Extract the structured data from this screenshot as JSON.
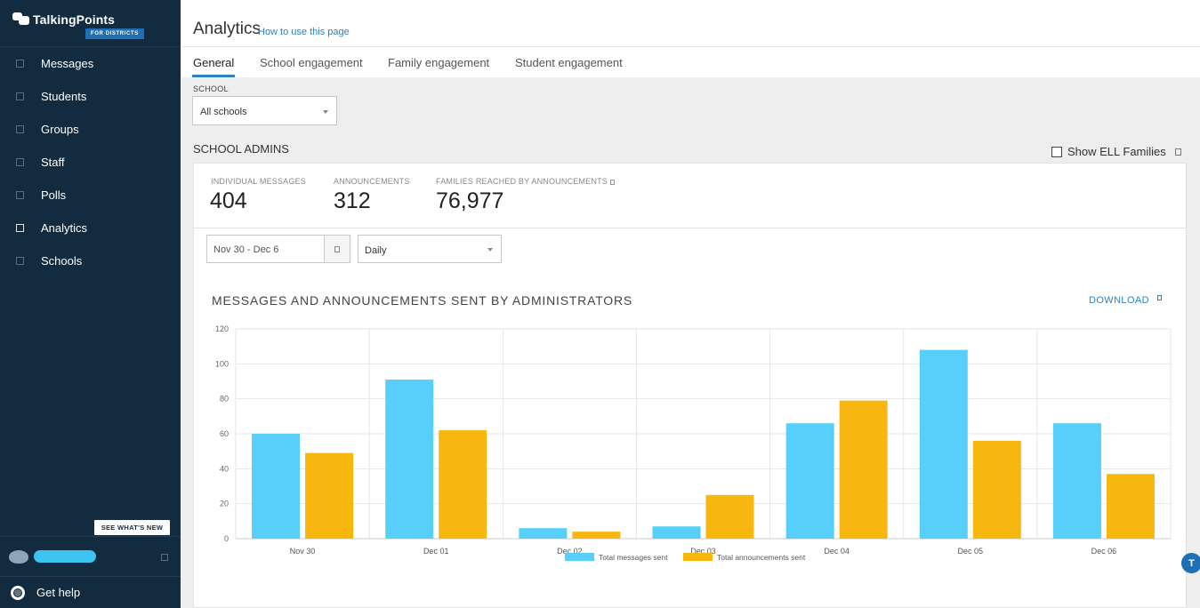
{
  "sidebar": {
    "logo_text": "TalkingPoints",
    "logo_badge": "FOR DISTRICTS",
    "items": [
      {
        "label": "Messages",
        "icon": "chat-icon"
      },
      {
        "label": "Students",
        "icon": "students-icon"
      },
      {
        "label": "Groups",
        "icon": "groups-icon"
      },
      {
        "label": "Staff",
        "icon": "staff-icon"
      },
      {
        "label": "Polls",
        "icon": "polls-icon"
      },
      {
        "label": "Analytics",
        "icon": "analytics-icon",
        "active": true
      },
      {
        "label": "Schools",
        "icon": "schools-icon"
      }
    ],
    "whats_new": "SEE WHAT'S NEW",
    "help": "Get help"
  },
  "header": {
    "title": "Analytics",
    "howto": "How to use this page"
  },
  "tabs": [
    "General",
    "School engagement",
    "Family engagement",
    "Student engagement"
  ],
  "filters": {
    "school_label": "SCHOOL",
    "school_value": "All schools",
    "date_range": "Nov 30 - Dec 6",
    "frequency": "Daily"
  },
  "section": {
    "title": "SCHOOL ADMINS",
    "ell_label": "Show ELL Families"
  },
  "stats": [
    {
      "label": "INDIVIDUAL MESSAGES",
      "value": "404"
    },
    {
      "label": "ANNOUNCEMENTS",
      "value": "312"
    },
    {
      "label": "FAMILIES REACHED BY ANNOUNCEMENTS",
      "value": "76,977"
    }
  ],
  "download_label": "DOWNLOAD",
  "fab_label": "T",
  "colors": {
    "sidebar_bg": "#122b3f",
    "accent": "#2a82c7",
    "series_messages": "#57cffa",
    "series_announcements": "#f7b70f"
  },
  "chart_data": {
    "type": "bar",
    "title": "MESSAGES AND ANNOUNCEMENTS SENT BY ADMINISTRATORS",
    "categories": [
      "Nov 30",
      "Dec 01",
      "Dec 02",
      "Dec 03",
      "Dec 04",
      "Dec 05",
      "Dec 06"
    ],
    "series": [
      {
        "name": "Total messages sent",
        "values": [
          60,
          91,
          6,
          7,
          66,
          108,
          66
        ]
      },
      {
        "name": "Total announcements sent",
        "values": [
          49,
          62,
          4,
          25,
          79,
          56,
          37
        ]
      }
    ],
    "y_ticks": [
      0,
      20,
      40,
      60,
      80,
      100,
      120
    ],
    "ylim": [
      0,
      120
    ],
    "grid": true,
    "legend": "bottom-center"
  }
}
